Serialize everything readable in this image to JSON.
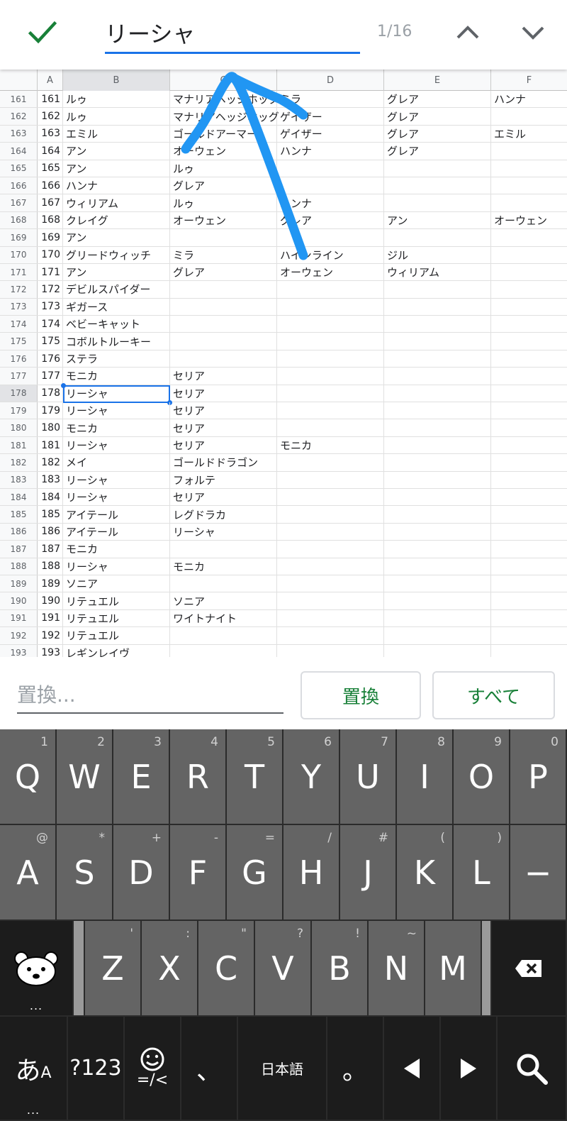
{
  "find": {
    "query": "リーシャ",
    "counter": "1/16"
  },
  "columns": [
    "A",
    "B",
    "C",
    "D",
    "E",
    "F"
  ],
  "rows": [
    {
      "n": "161",
      "a": "161",
      "b": "ルゥ",
      "c": "マナリアヘッジホッグ",
      "d": "ミラ",
      "e": "グレア",
      "f": "ハンナ"
    },
    {
      "n": "162",
      "a": "162",
      "b": "ルゥ",
      "c": "マナリアヘッジホッグ",
      "d": "ゲイザー",
      "e": "グレア",
      "f": ""
    },
    {
      "n": "163",
      "a": "163",
      "b": "エミル",
      "c": "ゴールドアーマー",
      "d": "ゲイザー",
      "e": "グレア",
      "f": "エミル"
    },
    {
      "n": "164",
      "a": "164",
      "b": "アン",
      "c": "オーウェン",
      "d": "ハンナ",
      "e": "グレア",
      "f": ""
    },
    {
      "n": "165",
      "a": "165",
      "b": "アン",
      "c": "ルゥ",
      "d": "",
      "e": "",
      "f": ""
    },
    {
      "n": "166",
      "a": "166",
      "b": "ハンナ",
      "c": "グレア",
      "d": "",
      "e": "",
      "f": ""
    },
    {
      "n": "167",
      "a": "167",
      "b": "ウィリアム",
      "c": "ルゥ",
      "d": "ハンナ",
      "e": "",
      "f": ""
    },
    {
      "n": "168",
      "a": "168",
      "b": "クレイグ",
      "c": "オーウェン",
      "d": "グレア",
      "e": "アン",
      "f": "オーウェン"
    },
    {
      "n": "169",
      "a": "169",
      "b": "アン",
      "c": "",
      "d": "",
      "e": "",
      "f": ""
    },
    {
      "n": "170",
      "a": "170",
      "b": "グリードウィッチ",
      "c": "ミラ",
      "d": "ハインライン",
      "e": "ジル",
      "f": ""
    },
    {
      "n": "171",
      "a": "171",
      "b": "アン",
      "c": "グレア",
      "d": "オーウェン",
      "e": "ウィリアム",
      "f": ""
    },
    {
      "n": "172",
      "a": "172",
      "b": "デビルスパイダー",
      "c": "",
      "d": "",
      "e": "",
      "f": ""
    },
    {
      "n": "173",
      "a": "173",
      "b": "ギガース",
      "c": "",
      "d": "",
      "e": "",
      "f": ""
    },
    {
      "n": "174",
      "a": "174",
      "b": "ベビーキャット",
      "c": "",
      "d": "",
      "e": "",
      "f": ""
    },
    {
      "n": "175",
      "a": "175",
      "b": "コボルトルーキー",
      "c": "",
      "d": "",
      "e": "",
      "f": ""
    },
    {
      "n": "176",
      "a": "176",
      "b": "ステラ",
      "c": "",
      "d": "",
      "e": "",
      "f": ""
    },
    {
      "n": "177",
      "a": "177",
      "b": "モニカ",
      "c": "セリア",
      "d": "",
      "e": "",
      "f": ""
    },
    {
      "n": "178",
      "a": "178",
      "b": "リーシャ",
      "c": "セリア",
      "d": "",
      "e": "",
      "f": ""
    },
    {
      "n": "179",
      "a": "179",
      "b": "リーシャ",
      "c": "セリア",
      "d": "",
      "e": "",
      "f": ""
    },
    {
      "n": "180",
      "a": "180",
      "b": "モニカ",
      "c": "セリア",
      "d": "",
      "e": "",
      "f": ""
    },
    {
      "n": "181",
      "a": "181",
      "b": "リーシャ",
      "c": "セリア",
      "d": "モニカ",
      "e": "",
      "f": ""
    },
    {
      "n": "182",
      "a": "182",
      "b": "メイ",
      "c": "ゴールドドラゴン",
      "d": "",
      "e": "",
      "f": ""
    },
    {
      "n": "183",
      "a": "183",
      "b": "リーシャ",
      "c": "フォルテ",
      "d": "",
      "e": "",
      "f": ""
    },
    {
      "n": "184",
      "a": "184",
      "b": "リーシャ",
      "c": "セリア",
      "d": "",
      "e": "",
      "f": ""
    },
    {
      "n": "185",
      "a": "185",
      "b": "アイテール",
      "c": "レグドラカ",
      "d": "",
      "e": "",
      "f": ""
    },
    {
      "n": "186",
      "a": "186",
      "b": "アイテール",
      "c": "リーシャ",
      "d": "",
      "e": "",
      "f": ""
    },
    {
      "n": "187",
      "a": "187",
      "b": "モニカ",
      "c": "",
      "d": "",
      "e": "",
      "f": ""
    },
    {
      "n": "188",
      "a": "188",
      "b": "リーシャ",
      "c": "モニカ",
      "d": "",
      "e": "",
      "f": ""
    },
    {
      "n": "189",
      "a": "189",
      "b": "ソニア",
      "c": "",
      "d": "",
      "e": "",
      "f": ""
    },
    {
      "n": "190",
      "a": "190",
      "b": "リテュエル",
      "c": "ソニア",
      "d": "",
      "e": "",
      "f": ""
    },
    {
      "n": "191",
      "a": "191",
      "b": "リテュエル",
      "c": "ワイトナイト",
      "d": "",
      "e": "",
      "f": ""
    },
    {
      "n": "192",
      "a": "192",
      "b": "リテュエル",
      "c": "",
      "d": "",
      "e": "",
      "f": ""
    },
    {
      "n": "193",
      "a": "193",
      "b": "レギンレイヴ",
      "c": "",
      "d": "",
      "e": "",
      "f": ""
    }
  ],
  "selected_row": "178",
  "replace": {
    "placeholder": "置換...",
    "replace_label": "置換",
    "replace_all_label": "すべて"
  },
  "keyboard": {
    "row1": [
      {
        "k": "Q",
        "h": "1"
      },
      {
        "k": "W",
        "h": "2"
      },
      {
        "k": "E",
        "h": "3"
      },
      {
        "k": "R",
        "h": "4"
      },
      {
        "k": "T",
        "h": "5"
      },
      {
        "k": "Y",
        "h": "6"
      },
      {
        "k": "U",
        "h": "7"
      },
      {
        "k": "I",
        "h": "8"
      },
      {
        "k": "O",
        "h": "9"
      },
      {
        "k": "P",
        "h": "0"
      }
    ],
    "row2": [
      {
        "k": "A",
        "h": "@"
      },
      {
        "k": "S",
        "h": "*"
      },
      {
        "k": "D",
        "h": "+"
      },
      {
        "k": "F",
        "h": "-"
      },
      {
        "k": "G",
        "h": "="
      },
      {
        "k": "H",
        "h": "/"
      },
      {
        "k": "J",
        "h": "#"
      },
      {
        "k": "K",
        "h": "("
      },
      {
        "k": "L",
        "h": ")"
      },
      {
        "k": "−",
        "h": ""
      }
    ],
    "row3": [
      {
        "k": "Z",
        "h": "'"
      },
      {
        "k": "X",
        "h": ":"
      },
      {
        "k": "C",
        "h": "\""
      },
      {
        "k": "V",
        "h": "?"
      },
      {
        "k": "B",
        "h": "!"
      },
      {
        "k": "N",
        "h": "~"
      },
      {
        "k": "M",
        "h": ""
      }
    ],
    "kana_label": "あ",
    "kana_sub": "A",
    "symbols_label": "?123",
    "emoji_sub": "=/<",
    "comma": "、",
    "lang_label": "日本語",
    "period": "。",
    "dots": "..."
  },
  "colors": {
    "accent": "#1a73e8",
    "button_text": "#188038",
    "check": "#188038",
    "annotation": "#2196f3"
  }
}
